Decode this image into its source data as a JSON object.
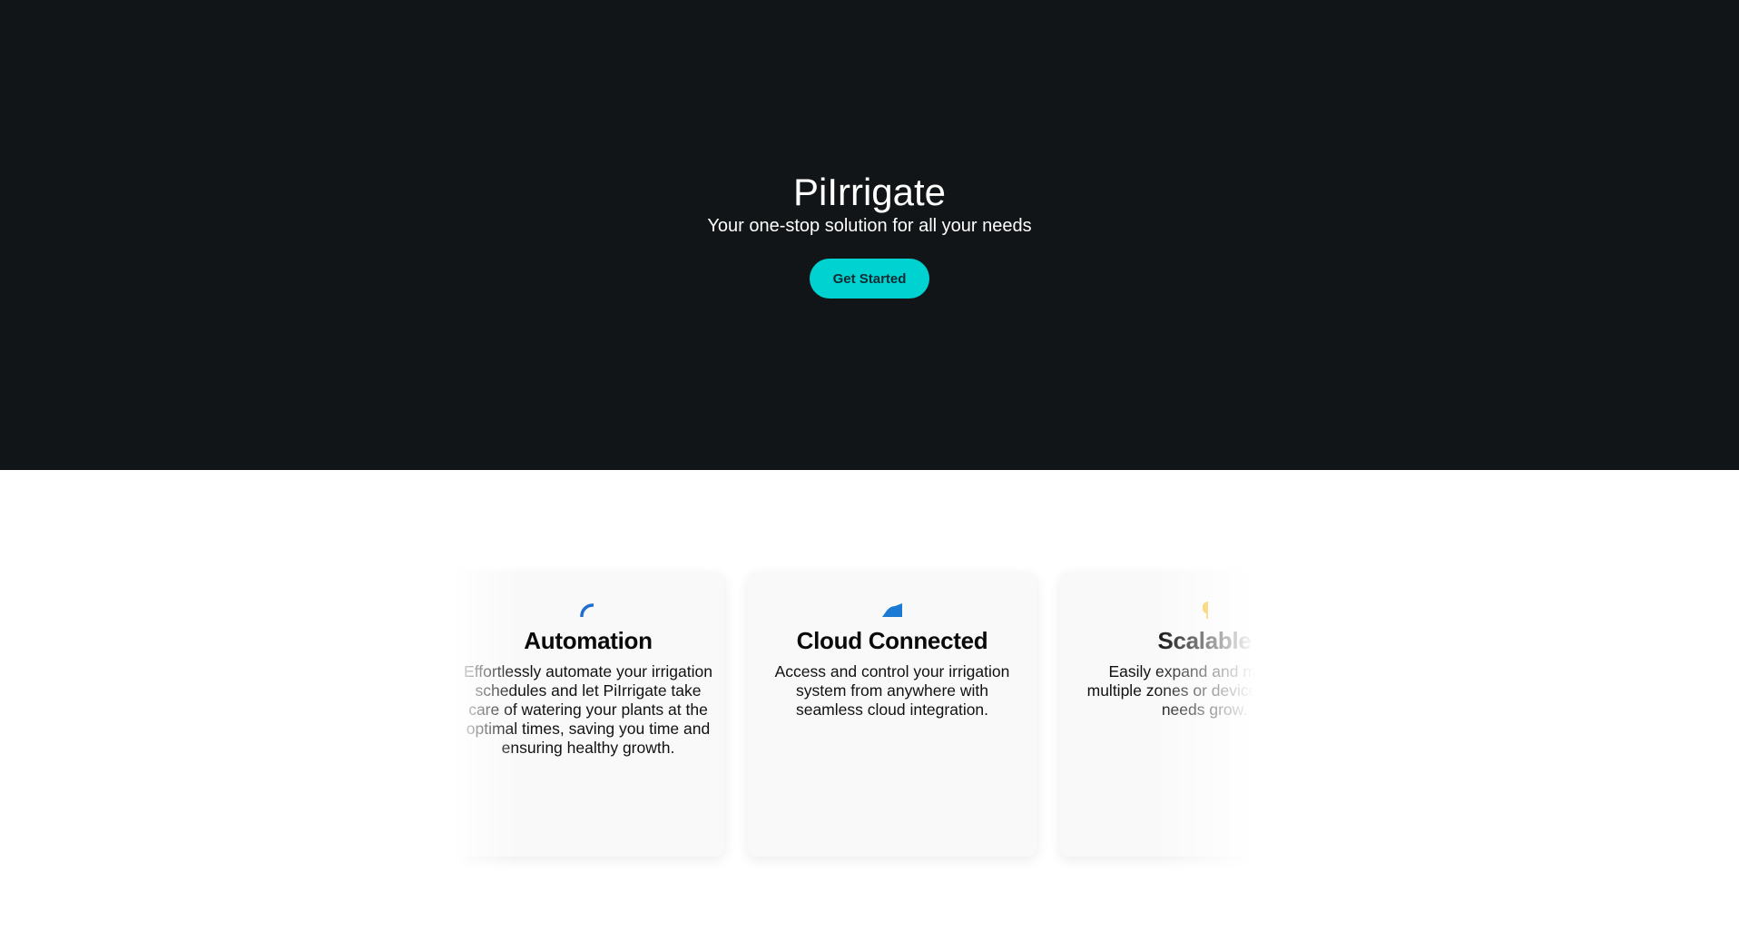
{
  "hero": {
    "title": "PiIrrigate",
    "subtitle": "Your one-stop solution for all your needs",
    "cta_label": "Get Started"
  },
  "features": [
    {
      "icon": "automation-gauge-icon",
      "icon_color": "#1e6fd0",
      "title": "Automation",
      "text": "Effortlessly automate your irrigation schedules and let PiIrrigate take care of watering your plants at the optimal times, saving you time and ensuring healthy growth."
    },
    {
      "icon": "cloud-signal-icon",
      "icon_color": "#1a7ad4",
      "title": "Cloud Connected",
      "text": "Access and control your irrigation system from anywhere with seamless cloud integration."
    },
    {
      "icon": "scalable-expand-icon",
      "icon_color": "#f5b301",
      "title": "Scalable",
      "text": "Easily expand and manage multiple zones or devices as your needs grow."
    }
  ],
  "colors": {
    "hero_bg": "#111517",
    "accent": "#00d1d1",
    "card_bg": "#f9f9f9"
  }
}
